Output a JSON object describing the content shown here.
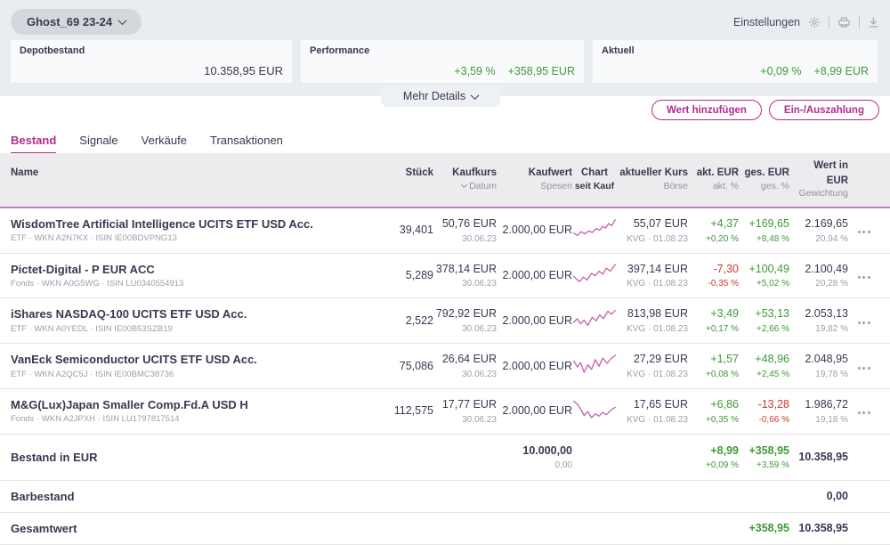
{
  "header": {
    "portfolio_name": "Ghost_69 23-24",
    "settings_label": "Einstellungen",
    "more_details_label": "Mehr Details",
    "cards": {
      "depot": {
        "label": "Depotbestand",
        "value": "10.358,95 EUR"
      },
      "perf": {
        "label": "Performance",
        "percent": "+3,59 %",
        "amount": "+358,95 EUR"
      },
      "aktuell": {
        "label": "Aktuell",
        "percent": "+0,09 %",
        "amount": "+8,99 EUR"
      }
    },
    "icons": [
      "gear-icon",
      "printer-icon",
      "download-icon",
      "chevron-down-icon"
    ]
  },
  "actions": {
    "add_value_label": "Wert hinzufügen",
    "deposit_label": "Ein-/Auszahlung"
  },
  "tabs": [
    {
      "label": "Bestand",
      "active": true
    },
    {
      "label": "Signale",
      "active": false
    },
    {
      "label": "Verkäufe",
      "active": false
    },
    {
      "label": "Transaktionen",
      "active": false
    }
  ],
  "table": {
    "columns": {
      "name": {
        "l1": "Name",
        "l2": ""
      },
      "shares": {
        "l1": "Stück",
        "l2": ""
      },
      "buy_price": {
        "l1": "Kaufkurs",
        "l2": "Datum",
        "sortable": true
      },
      "buy_value": {
        "l1": "Kaufwert",
        "l2": "Spesen"
      },
      "chart": {
        "l1": "Chart",
        "l2": "seit Kauf"
      },
      "cur_price": {
        "l1": "aktueller Kurs",
        "l2": "Börse"
      },
      "day": {
        "l1": "akt. EUR",
        "l2": "akt. %"
      },
      "total": {
        "l1": "ges. EUR",
        "l2": "ges. %"
      },
      "value": {
        "l1": "Wert in EUR",
        "l2": "Gewichtung"
      }
    },
    "rows": [
      {
        "name": "WisdomTree Artificial Intelligence UCITS ETF USD Acc.",
        "subtitle": "ETF · WKN A2N7KX · ISIN IE00BDVPNG13",
        "shares": "39,401",
        "buy_price": "50,76 EUR",
        "buy_date": "30.06.23",
        "buy_value": "2.000,00 EUR",
        "cur_price": "55,07 EUR",
        "price_source": "KVG · 01.08.23",
        "day_eur": "+4,37",
        "day_pct": "+0,20 %",
        "total_eur": "+169,65",
        "total_pct": "+8,48 %",
        "value_eur": "2.169,65",
        "weight": "20,94 %",
        "spark": [
          [
            2,
            22
          ],
          [
            7,
            25
          ],
          [
            12,
            20
          ],
          [
            17,
            23
          ],
          [
            22,
            19
          ],
          [
            27,
            21
          ],
          [
            32,
            16
          ],
          [
            37,
            18
          ],
          [
            41,
            13
          ],
          [
            45,
            15
          ],
          [
            49,
            9
          ],
          [
            53,
            12
          ],
          [
            58,
            4
          ]
        ]
      },
      {
        "name": "Pictet-Digital - P EUR ACC",
        "subtitle": "Fonds · WKN A0G5WG · ISIN LU0340554913",
        "shares": "5,289",
        "buy_price": "378,14 EUR",
        "buy_date": "30.06.23",
        "buy_value": "2.000,00 EUR",
        "cur_price": "397,14 EUR",
        "price_source": "KVG · 01.08.23",
        "day_eur": "-7,30",
        "day_pct": "-0,35 %",
        "total_eur": "+100,49",
        "total_pct": "+5,02 %",
        "value_eur": "2.100,49",
        "weight": "20,28 %",
        "spark": [
          [
            2,
            19
          ],
          [
            6,
            23
          ],
          [
            10,
            26
          ],
          [
            15,
            20
          ],
          [
            20,
            24
          ],
          [
            26,
            15
          ],
          [
            31,
            18
          ],
          [
            36,
            12
          ],
          [
            41,
            16
          ],
          [
            46,
            8
          ],
          [
            51,
            12
          ],
          [
            58,
            3
          ]
        ]
      },
      {
        "name": "iShares NASDAQ-100 UCITS ETF USD Acc.",
        "subtitle": "ETF · WKN A0YEDL · ISIN IE00B53SZB19",
        "shares": "2,522",
        "buy_price": "792,92 EUR",
        "buy_date": "30.06.23",
        "buy_value": "2.000,00 EUR",
        "cur_price": "813,98 EUR",
        "price_source": "KVG · 01.08.23",
        "day_eur": "+3,49",
        "day_pct": "+0,17 %",
        "total_eur": "+53,13",
        "total_pct": "+2,66 %",
        "value_eur": "2.053,13",
        "weight": "19,82 %",
        "spark": [
          [
            2,
            21
          ],
          [
            7,
            16
          ],
          [
            11,
            23
          ],
          [
            16,
            18
          ],
          [
            21,
            25
          ],
          [
            27,
            14
          ],
          [
            32,
            19
          ],
          [
            37,
            11
          ],
          [
            42,
            16
          ],
          [
            48,
            6
          ],
          [
            53,
            10
          ],
          [
            58,
            5
          ]
        ]
      },
      {
        "name": "VanEck Semiconductor UCITS ETF USD Acc.",
        "subtitle": "ETF · WKN A2QC5J · ISIN IE00BMC38736",
        "shares": "75,086",
        "buy_price": "26,64 EUR",
        "buy_date": "30.06.23",
        "buy_value": "2.000,00 EUR",
        "cur_price": "27,29 EUR",
        "price_source": "KVG · 01.08.23",
        "day_eur": "+1,57",
        "day_pct": "+0,08 %",
        "total_eur": "+48,96",
        "total_pct": "+2,45 %",
        "value_eur": "2.048,95",
        "weight": "19,78 %",
        "spark": [
          [
            2,
            12
          ],
          [
            7,
            20
          ],
          [
            11,
            14
          ],
          [
            16,
            27
          ],
          [
            21,
            17
          ],
          [
            26,
            23
          ],
          [
            31,
            10
          ],
          [
            36,
            19
          ],
          [
            41,
            8
          ],
          [
            47,
            15
          ],
          [
            52,
            9
          ],
          [
            58,
            4
          ]
        ]
      },
      {
        "name": "M&G(Lux)Japan Smaller Comp.Fd.A USD H",
        "subtitle": "Fonds · WKN A2JPXH · ISIN LU1797817514",
        "shares": "112,575",
        "buy_price": "17,77 EUR",
        "buy_date": "30.06.23",
        "buy_value": "2.000,00 EUR",
        "cur_price": "17,65 EUR",
        "price_source": "KVG · 01.08.23",
        "day_eur": "+6,86",
        "day_pct": "+0,35 %",
        "total_eur": "-13,28",
        "total_pct": "-0,66 %",
        "value_eur": "1.986,72",
        "weight": "19,18 %",
        "spark": [
          [
            2,
            5
          ],
          [
            7,
            9
          ],
          [
            11,
            15
          ],
          [
            16,
            24
          ],
          [
            21,
            19
          ],
          [
            26,
            27
          ],
          [
            31,
            22
          ],
          [
            36,
            25
          ],
          [
            41,
            20
          ],
          [
            46,
            23
          ],
          [
            52,
            17
          ],
          [
            58,
            13
          ]
        ]
      }
    ],
    "summary": {
      "bestand": {
        "label": "Bestand in EUR",
        "buy_value": "10.000,00",
        "buy_value_sub": "0,00",
        "day_eur": "+8,99",
        "day_pct": "+0,09 %",
        "total_eur": "+358,95",
        "total_pct": "+3,59 %",
        "value_eur": "10.358,95"
      },
      "barbestand": {
        "label": "Barbestand",
        "value_eur": "0,00"
      },
      "gesamtwert": {
        "label": "Gesamtwert",
        "total_eur": "+358,95",
        "value_eur": "10.358,95"
      }
    }
  },
  "colors": {
    "accent_magenta": "#b42b8c",
    "sparkline": "#c661ae",
    "positive_green": "#3d9b35",
    "negative_red": "#cf3630",
    "band_background": "#e9edf1",
    "table_header_background": "#ececee"
  }
}
